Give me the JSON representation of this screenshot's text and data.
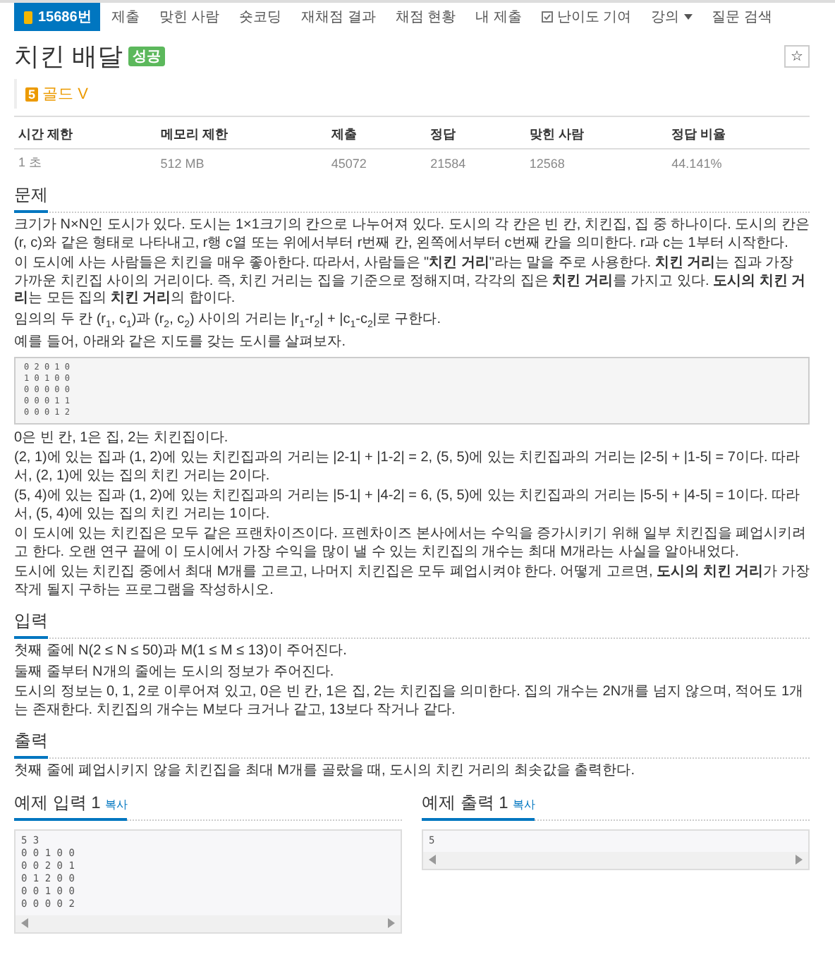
{
  "nav": [
    {
      "label": "15686번",
      "kind": "problem",
      "selected": true
    },
    {
      "label": "제출",
      "kind": "link",
      "selected": false
    },
    {
      "label": "맞힌 사람",
      "kind": "link",
      "selected": false
    },
    {
      "label": "숏코딩",
      "kind": "link",
      "selected": false
    },
    {
      "label": "재채점 결과",
      "kind": "link",
      "selected": false
    },
    {
      "label": "채점 현황",
      "kind": "link",
      "selected": false
    },
    {
      "label": "내 제출",
      "kind": "link",
      "selected": false
    },
    {
      "label": "난이도 기여",
      "kind": "contribute",
      "selected": false
    },
    {
      "label": "강의",
      "kind": "dropdown",
      "selected": false
    },
    {
      "label": "질문 검색",
      "kind": "link",
      "selected": false
    }
  ],
  "problem": {
    "title": "치킨 배달",
    "badge": "성공",
    "tier": {
      "icon": "5",
      "label": "골드 V"
    },
    "star": "☆"
  },
  "table": {
    "columns": [
      "시간 제한",
      "메모리 제한",
      "제출",
      "정답",
      "맞힌 사람",
      "정답 비율"
    ],
    "rows": [
      [
        "1 초",
        "512 MB",
        "45072",
        "21584",
        "12568",
        "44.141%"
      ]
    ]
  },
  "sections": [
    {
      "title": "문제",
      "blocks": [
        {
          "kind": "text",
          "text": "크기가 N×N인 도시가 있다. 도시는 1×1크기의 칸으로 나누어져 있다. 도시의 각 칸은 빈 칸, 치킨집, 집 중 하나이다. 도시의 칸은 (r, c)와 같은 형태로 나타내고, r행 c열 또는 위에서부터 r번째 칸, 왼쪽에서부터 c번째 칸을 의미한다. r과 c는 1부터 시작한다."
        },
        {
          "kind": "text",
          "text": "이 도시에 사는 사람들은 치킨을 매우 좋아한다. 따라서, 사람들은 \"**치킨 거리**\"라는 말을 주로 사용한다. **치킨 거리**는 집과 가장 가까운 치킨집 사이의 거리이다. 즉, 치킨 거리는 집을 기준으로 정해지며, 각각의 집은 **치킨 거리**를 가지고 있다. **도시의 치킨 거리**는 모든 집의 **치킨 거리**의 합이다."
        },
        {
          "kind": "text",
          "text": "임의의 두 칸 (r$_{1}$, c$_{1}$)과 (r$_{2}$, c$_{2}$) 사이의 거리는 |r$_{1}$-r$_{2}$| + |c$_{1}$-c$_{2}$|로 구한다."
        },
        {
          "kind": "text",
          "text": "예를 들어, 아래와 같은 지도를 갖는 도시를 살펴보자."
        },
        {
          "kind": "pre",
          "text": "0 2 0 1 0\n1 0 1 0 0\n0 0 0 0 0\n0 0 0 1 1\n0 0 0 1 2"
        },
        {
          "kind": "text",
          "text": "0은 빈 칸, 1은 집, 2는 치킨집이다."
        },
        {
          "kind": "text",
          "text": "(2, 1)에 있는 집과 (1, 2)에 있는 치킨집과의 거리는 |2-1| + |1-2| = 2, (5, 5)에 있는 치킨집과의 거리는 |2-5| + |1-5| = 7이다. 따라서, (2, 1)에 있는 집의 치킨 거리는 2이다."
        },
        {
          "kind": "text",
          "text": "(5, 4)에 있는 집과 (1, 2)에 있는 치킨집과의 거리는 |5-1| + |4-2| = 6, (5, 5)에 있는 치킨집과의 거리는 |5-5| + |4-5| = 1이다. 따라서, (5, 4)에 있는 집의 치킨 거리는 1이다."
        },
        {
          "kind": "text",
          "text": "이 도시에 있는 치킨집은 모두 같은 프랜차이즈이다. 프렌차이즈 본사에서는 수익을 증가시키기 위해 일부 치킨집을 폐업시키려고 한다. 오랜 연구 끝에 이 도시에서 가장 수익을 많이 낼 수 있는 치킨집의 개수는 최대 M개라는 사실을 알아내었다."
        },
        {
          "kind": "text",
          "text": "도시에 있는 치킨집 중에서 최대 M개를 고르고, 나머지 치킨집은 모두 폐업시켜야 한다. 어떻게 고르면, **도시의 치킨 거리**가 가장 작게 될지 구하는 프로그램을 작성하시오."
        }
      ]
    },
    {
      "title": "입력",
      "blocks": [
        {
          "kind": "text",
          "text": "첫째 줄에 N(2 ≤ N ≤ 50)과 M(1 ≤ M ≤ 13)이 주어진다."
        },
        {
          "kind": "text",
          "text": "둘째 줄부터 N개의 줄에는 도시의 정보가 주어진다."
        },
        {
          "kind": "text",
          "text": "도시의 정보는 0, 1, 2로 이루어져 있고, 0은 빈 칸, 1은 집, 2는 치킨집을 의미한다. 집의 개수는 2N개를 넘지 않으며, 적어도 1개는 존재한다. 치킨집의 개수는 M보다 크거나 같고, 13보다 작거나 같다."
        }
      ]
    },
    {
      "title": "출력",
      "blocks": [
        {
          "kind": "text",
          "text": "첫째 줄에 폐업시키지 않을 치킨집을 최대 M개를 골랐을 때, 도시의 치킨 거리의 최솟값을 출력한다."
        }
      ]
    }
  ],
  "examples": [
    {
      "title": "예제 입력 1",
      "copy": "복사",
      "text": "5 3\n0 0 1 0 0\n0 0 2 0 1\n0 1 2 0 0\n0 0 1 0 0\n0 0 0 0 2"
    },
    {
      "title": "예제 출력 1",
      "copy": "복사",
      "text": "5"
    }
  ]
}
